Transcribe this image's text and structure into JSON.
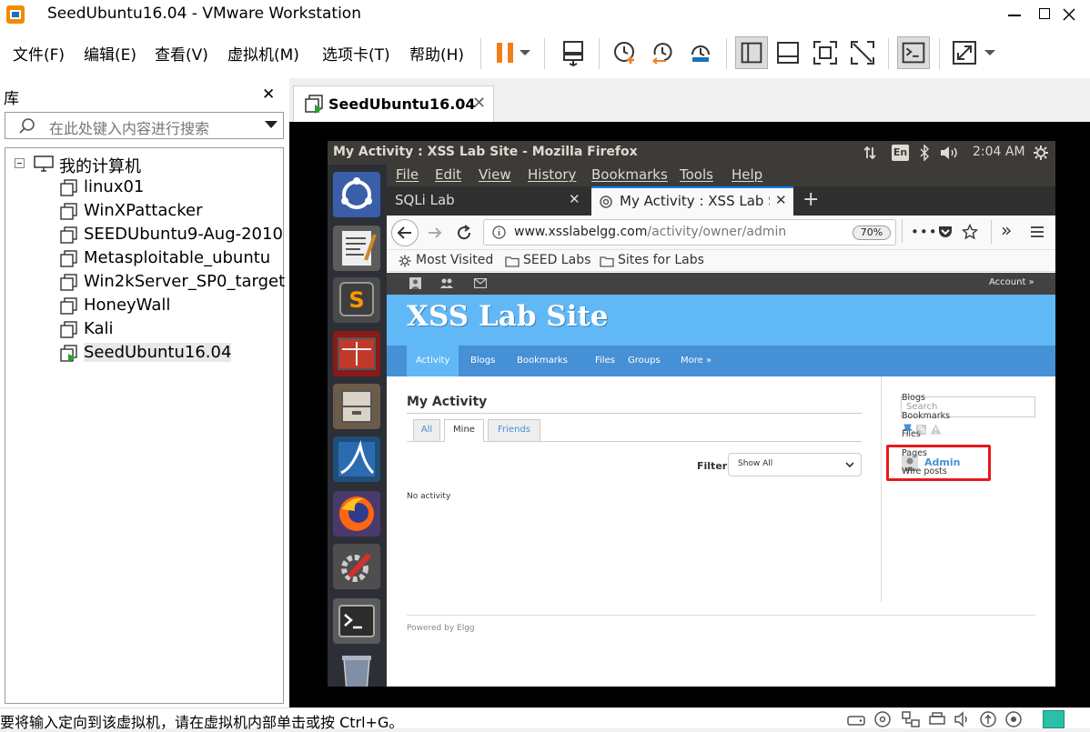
{
  "window": {
    "title": "SeedUbuntu16.04 - VMware Workstation",
    "controls": {
      "minimize": "—",
      "maximize": "☐",
      "close": "✕"
    }
  },
  "menu": [
    "文件(F)",
    "编辑(E)",
    "查看(V)",
    "虚拟机(M)",
    "选项卡(T)",
    "帮助(H)"
  ],
  "toolbar_icons": [
    "pause-icon",
    "dropdown-icon",
    "send-ctrl-alt-del-icon",
    "snapshot-icon",
    "revert-snapshot-icon",
    "snapshot-manager-icon",
    "library-view-icon",
    "hide-tabs-icon",
    "full-screen-icon",
    "unity-icon",
    "console-view-icon",
    "stretch-icon"
  ],
  "library": {
    "title": "库",
    "close": "✕",
    "search_placeholder": "在此处键入内容进行搜索",
    "root": "我的计算机",
    "vms": [
      "linux01",
      "WinXPattacker",
      "SEEDUbuntu9-Aug-2010",
      "Metasploitable_ubuntu",
      "Win2kServer_SP0_target",
      "HoneyWall",
      "Kali",
      "SeedUbuntu16.04"
    ],
    "selected": "SeedUbuntu16.04"
  },
  "vm_tab": {
    "label": "SeedUbuntu16.04",
    "close": "✕"
  },
  "guest": {
    "window_title": "My Activity : XSS Lab Site - Mozilla Firefox",
    "indicator_lang": "En",
    "clock": "2:04 AM",
    "firefox": {
      "menu": [
        "File",
        "Edit",
        "View",
        "History",
        "Bookmarks",
        "Tools",
        "Help"
      ],
      "tabs": [
        {
          "label": "SQLi Lab",
          "close": "✕"
        },
        {
          "label": "My Activity : XSS Lab Site",
          "close": "✕"
        }
      ],
      "new_tab": "+",
      "url_host": "www.xsslabelgg.com",
      "url_path": "/activity/owner/admin",
      "zoom": "70%",
      "bookmarks": [
        "Most Visited",
        "SEED Labs",
        "Sites for Labs"
      ]
    },
    "elgg": {
      "account": "Account »",
      "site_name": "XSS Lab Site",
      "nav": [
        "Activity",
        "Blogs",
        "Bookmarks",
        "Files",
        "Groups",
        "More »"
      ],
      "heading": "My Activity",
      "tabs": [
        "All",
        "Mine",
        "Friends"
      ],
      "filter_label": "Filter",
      "filter_value": "Show All",
      "empty": "No activity",
      "powered": "Powered by Elgg",
      "search_placeholder": "Search",
      "owner": "Admin",
      "owner_links": [
        "Blogs",
        "Bookmarks",
        "Files",
        "Pages",
        "Wire posts"
      ]
    }
  },
  "status": "要将输入定向到该虚拟机，请在虚拟机内部单击或按 Ctrl+G。",
  "colors": {
    "accent_orange": "#f07e1b",
    "elgg_blue": "#4690d6",
    "elgg_header": "#60b8f7",
    "highlight_red": "#e8191c",
    "ubuntu_panel": "#3c3b37"
  }
}
